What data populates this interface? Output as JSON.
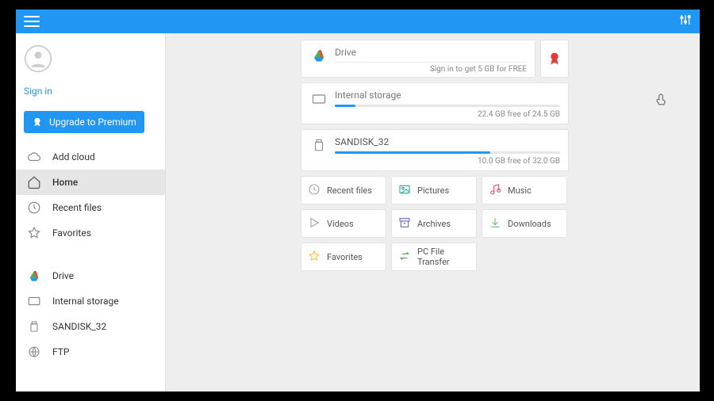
{
  "header": {},
  "sidebar": {
    "signin_label": "Sign in",
    "premium_label": "Upgrade to Premium",
    "nav1": [
      {
        "label": "Add cloud"
      },
      {
        "label": "Home"
      },
      {
        "label": "Recent files"
      },
      {
        "label": "Favorites"
      }
    ],
    "nav2": [
      {
        "label": "Drive"
      },
      {
        "label": "Internal storage"
      },
      {
        "label": "SANDISK_32"
      },
      {
        "label": "FTP"
      }
    ]
  },
  "storages": {
    "drive": {
      "title": "Drive",
      "sub": "Sign in to get 5 GB for FREE"
    },
    "internal": {
      "title": "Internal storage",
      "sub": "22.4 GB free of 24.5 GB",
      "fill_pct": 9
    },
    "sandisk": {
      "title": "SANDISK_32",
      "sub": "10.0 GB free of 32.0 GB",
      "fill_pct": 69
    }
  },
  "tiles": [
    {
      "label": "Recent files",
      "icon": "clock",
      "color": "#9e9e9e"
    },
    {
      "label": "Pictures",
      "icon": "image",
      "color": "#26a69a"
    },
    {
      "label": "Music",
      "icon": "music",
      "color": "#ec407a"
    },
    {
      "label": "Videos",
      "icon": "play",
      "color": "#9e9e9e"
    },
    {
      "label": "Archives",
      "icon": "archive",
      "color": "#5c6bc0"
    },
    {
      "label": "Downloads",
      "icon": "download",
      "color": "#66bb6a"
    },
    {
      "label": "Favorites",
      "icon": "star",
      "color": "#fbc02d"
    },
    {
      "label": "PC File Transfer",
      "icon": "transfer",
      "color": "#43a047"
    }
  ]
}
